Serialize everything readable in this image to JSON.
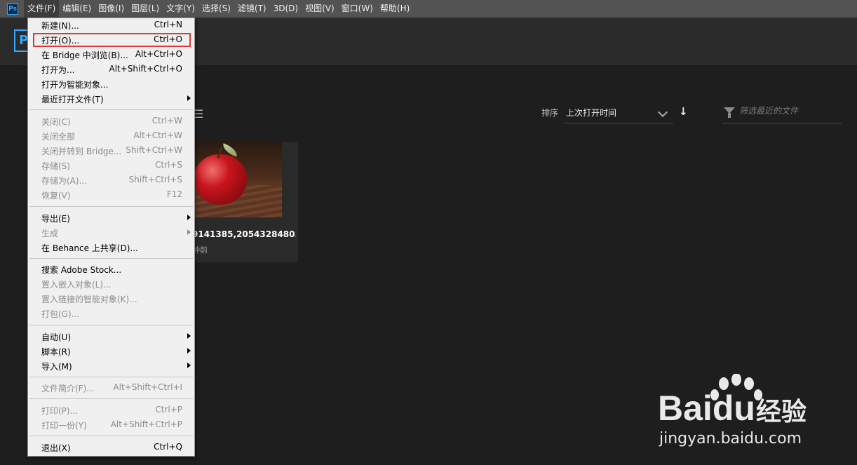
{
  "app": {
    "logo_text": "Ps",
    "home_logo_text": "P"
  },
  "menubar": {
    "items": [
      "文件(F)",
      "编辑(E)",
      "图像(I)",
      "图层(L)",
      "文字(Y)",
      "选择(S)",
      "滤镜(T)",
      "3D(D)",
      "视图(V)",
      "窗口(W)",
      "帮助(H)"
    ],
    "active_index": 0
  },
  "file_menu": {
    "items": [
      {
        "label": "新建(N)...",
        "shortcut": "Ctrl+N",
        "enabled": true,
        "submenu": false
      },
      {
        "label": "打开(O)...",
        "shortcut": "Ctrl+O",
        "enabled": true,
        "submenu": false,
        "highlighted": true
      },
      {
        "label": "在 Bridge 中浏览(B)...",
        "shortcut": "Alt+Ctrl+O",
        "enabled": true,
        "submenu": false
      },
      {
        "label": "打开为...",
        "shortcut": "Alt+Shift+Ctrl+O",
        "enabled": true,
        "submenu": false
      },
      {
        "label": "打开为智能对象...",
        "shortcut": "",
        "enabled": true,
        "submenu": false
      },
      {
        "label": "最近打开文件(T)",
        "shortcut": "",
        "enabled": true,
        "submenu": true
      },
      {
        "label": "关闭(C)",
        "shortcut": "Ctrl+W",
        "enabled": false,
        "submenu": false
      },
      {
        "label": "关闭全部",
        "shortcut": "Alt+Ctrl+W",
        "enabled": false,
        "submenu": false
      },
      {
        "label": "关闭并转到 Bridge...",
        "shortcut": "Shift+Ctrl+W",
        "enabled": false,
        "submenu": false
      },
      {
        "label": "存储(S)",
        "shortcut": "Ctrl+S",
        "enabled": false,
        "submenu": false
      },
      {
        "label": "存储为(A)...",
        "shortcut": "Shift+Ctrl+S",
        "enabled": false,
        "submenu": false
      },
      {
        "label": "恢复(V)",
        "shortcut": "F12",
        "enabled": false,
        "submenu": false
      },
      {
        "label": "导出(E)",
        "shortcut": "",
        "enabled": true,
        "submenu": true
      },
      {
        "label": "生成",
        "shortcut": "",
        "enabled": false,
        "submenu": true
      },
      {
        "label": "在 Behance 上共享(D)...",
        "shortcut": "",
        "enabled": true,
        "submenu": false
      },
      {
        "label": "搜索 Adobe Stock...",
        "shortcut": "",
        "enabled": true,
        "submenu": false
      },
      {
        "label": "置入嵌入对象(L)...",
        "shortcut": "",
        "enabled": false,
        "submenu": false
      },
      {
        "label": "置入链接的智能对象(K)...",
        "shortcut": "",
        "enabled": false,
        "submenu": false
      },
      {
        "label": "打包(G)...",
        "shortcut": "",
        "enabled": false,
        "submenu": false
      },
      {
        "label": "自动(U)",
        "shortcut": "",
        "enabled": true,
        "submenu": true
      },
      {
        "label": "脚本(R)",
        "shortcut": "",
        "enabled": true,
        "submenu": true
      },
      {
        "label": "导入(M)",
        "shortcut": "",
        "enabled": true,
        "submenu": true
      },
      {
        "label": "文件简介(F)...",
        "shortcut": "Alt+Shift+Ctrl+I",
        "enabled": false,
        "submenu": false
      },
      {
        "label": "打印(P)...",
        "shortcut": "Ctrl+P",
        "enabled": false,
        "submenu": false
      },
      {
        "label": "打印一份(Y)",
        "shortcut": "Alt+Shift+Ctrl+P",
        "enabled": false,
        "submenu": false
      },
      {
        "label": "退出(X)",
        "shortcut": "Ctrl+Q",
        "enabled": true,
        "submenu": false
      }
    ]
  },
  "home": {
    "sort_label": "排序",
    "sort_value": "上次打开时间",
    "filter_placeholder": "筛选最近的文件",
    "recent_file": {
      "name": "9141385,2054328480...",
      "time": "钟前"
    }
  },
  "watermark": {
    "brand_prefix": "Bai",
    "brand_mid": "du",
    "brand_suffix": "经验",
    "url": "jingyan.baidu.com"
  },
  "colors": {
    "accent": "#31a8ff",
    "highlight_border": "#e03a3a",
    "menu_bg": "#f0f0f0",
    "menubar_bg": "#535353"
  }
}
